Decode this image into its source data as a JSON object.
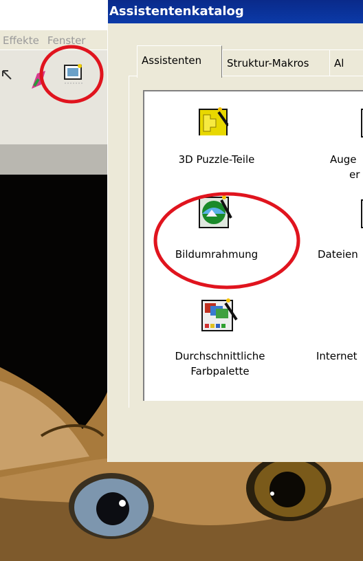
{
  "background_app": {
    "menu": [
      "Effekte",
      "Fenster"
    ]
  },
  "dialog": {
    "title": "Assistentenkatalog",
    "tabs": [
      {
        "label": "Assistenten",
        "active": true
      },
      {
        "label": "Struktur-Makros",
        "active": false
      },
      {
        "label": "Al",
        "active": false
      }
    ],
    "items": [
      {
        "label": "3D Puzzle-Teile",
        "icon": "puzzle-icon"
      },
      {
        "label": "Auge",
        "label2": "er",
        "icon": "wizard-icon"
      },
      {
        "label": "Bildumrahmung",
        "icon": "picture-frame-icon",
        "highlighted": true
      },
      {
        "label": "Dateien",
        "icon": "wizard-icon"
      },
      {
        "label": "Durchschnittliche",
        "label2": "Farbpalette",
        "icon": "color-palette-icon"
      },
      {
        "label": "Internet",
        "icon": "wizard-icon"
      }
    ]
  },
  "colors": {
    "annotation_circle": "#e0141e",
    "titlebar": "#0a2a8a"
  }
}
